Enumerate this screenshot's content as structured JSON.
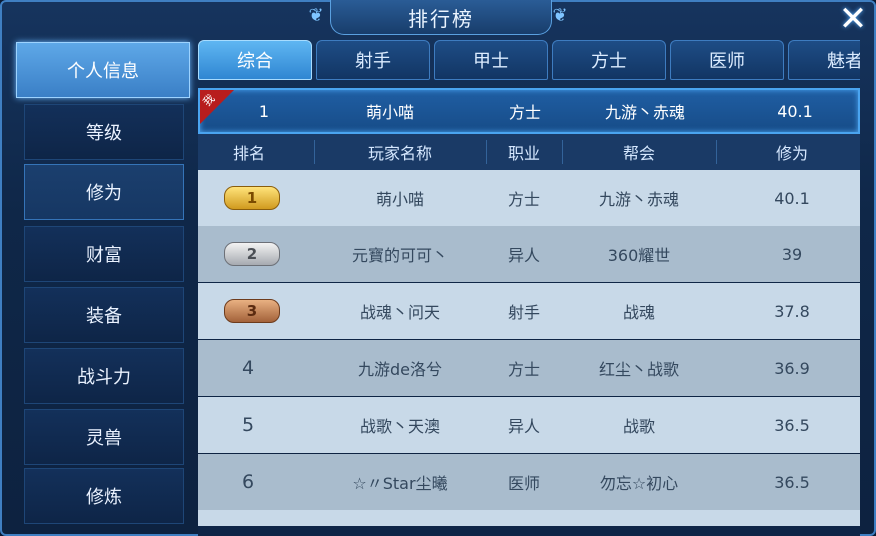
{
  "window": {
    "title": "排行榜",
    "close_label": "✕"
  },
  "sidebar": {
    "items": [
      {
        "label": "个人信息"
      },
      {
        "label": "等级"
      },
      {
        "label": "修为"
      },
      {
        "label": "财富"
      },
      {
        "label": "装备"
      },
      {
        "label": "战斗力"
      },
      {
        "label": "灵兽"
      },
      {
        "label": "修炼"
      }
    ],
    "active_index": 0,
    "selected_index": 2
  },
  "tabs": [
    {
      "label": "综合"
    },
    {
      "label": "射手"
    },
    {
      "label": "甲士"
    },
    {
      "label": "方士"
    },
    {
      "label": "医师"
    },
    {
      "label": "魅者"
    }
  ],
  "my_row": {
    "badge": "我",
    "rank": "1",
    "name": "萌小喵",
    "class": "方士",
    "guild": "九游丶赤魂",
    "score": "40.1"
  },
  "columns": [
    "排名",
    "玩家名称",
    "职业",
    "帮会",
    "修为"
  ],
  "rows": [
    {
      "rank": "1",
      "medal": "gold",
      "name": "萌小喵",
      "class": "方士",
      "guild": "九游丶赤魂",
      "score": "40.1"
    },
    {
      "rank": "2",
      "medal": "silver",
      "name": "元寶的可可丶",
      "class": "异人",
      "guild": "360耀世",
      "score": "39"
    },
    {
      "rank": "3",
      "medal": "bronze",
      "name": "战魂丶问天",
      "class": "射手",
      "guild": "战魂",
      "score": "37.8"
    },
    {
      "rank": "4",
      "medal": "",
      "name": "九游de洛兮",
      "class": "方士",
      "guild": "红尘丶战歌",
      "score": "36.9"
    },
    {
      "rank": "5",
      "medal": "",
      "name": "战歌丶天澳",
      "class": "异人",
      "guild": "战歌",
      "score": "36.5"
    },
    {
      "rank": "6",
      "medal": "",
      "name": "☆〃Star尘曦",
      "class": "医师",
      "guild": "勿忘☆初心",
      "score": "36.5"
    }
  ],
  "colors": {
    "accent": "#4aa4f0",
    "row_light": "#c8d9e8",
    "row_dark": "#a9bccd"
  }
}
